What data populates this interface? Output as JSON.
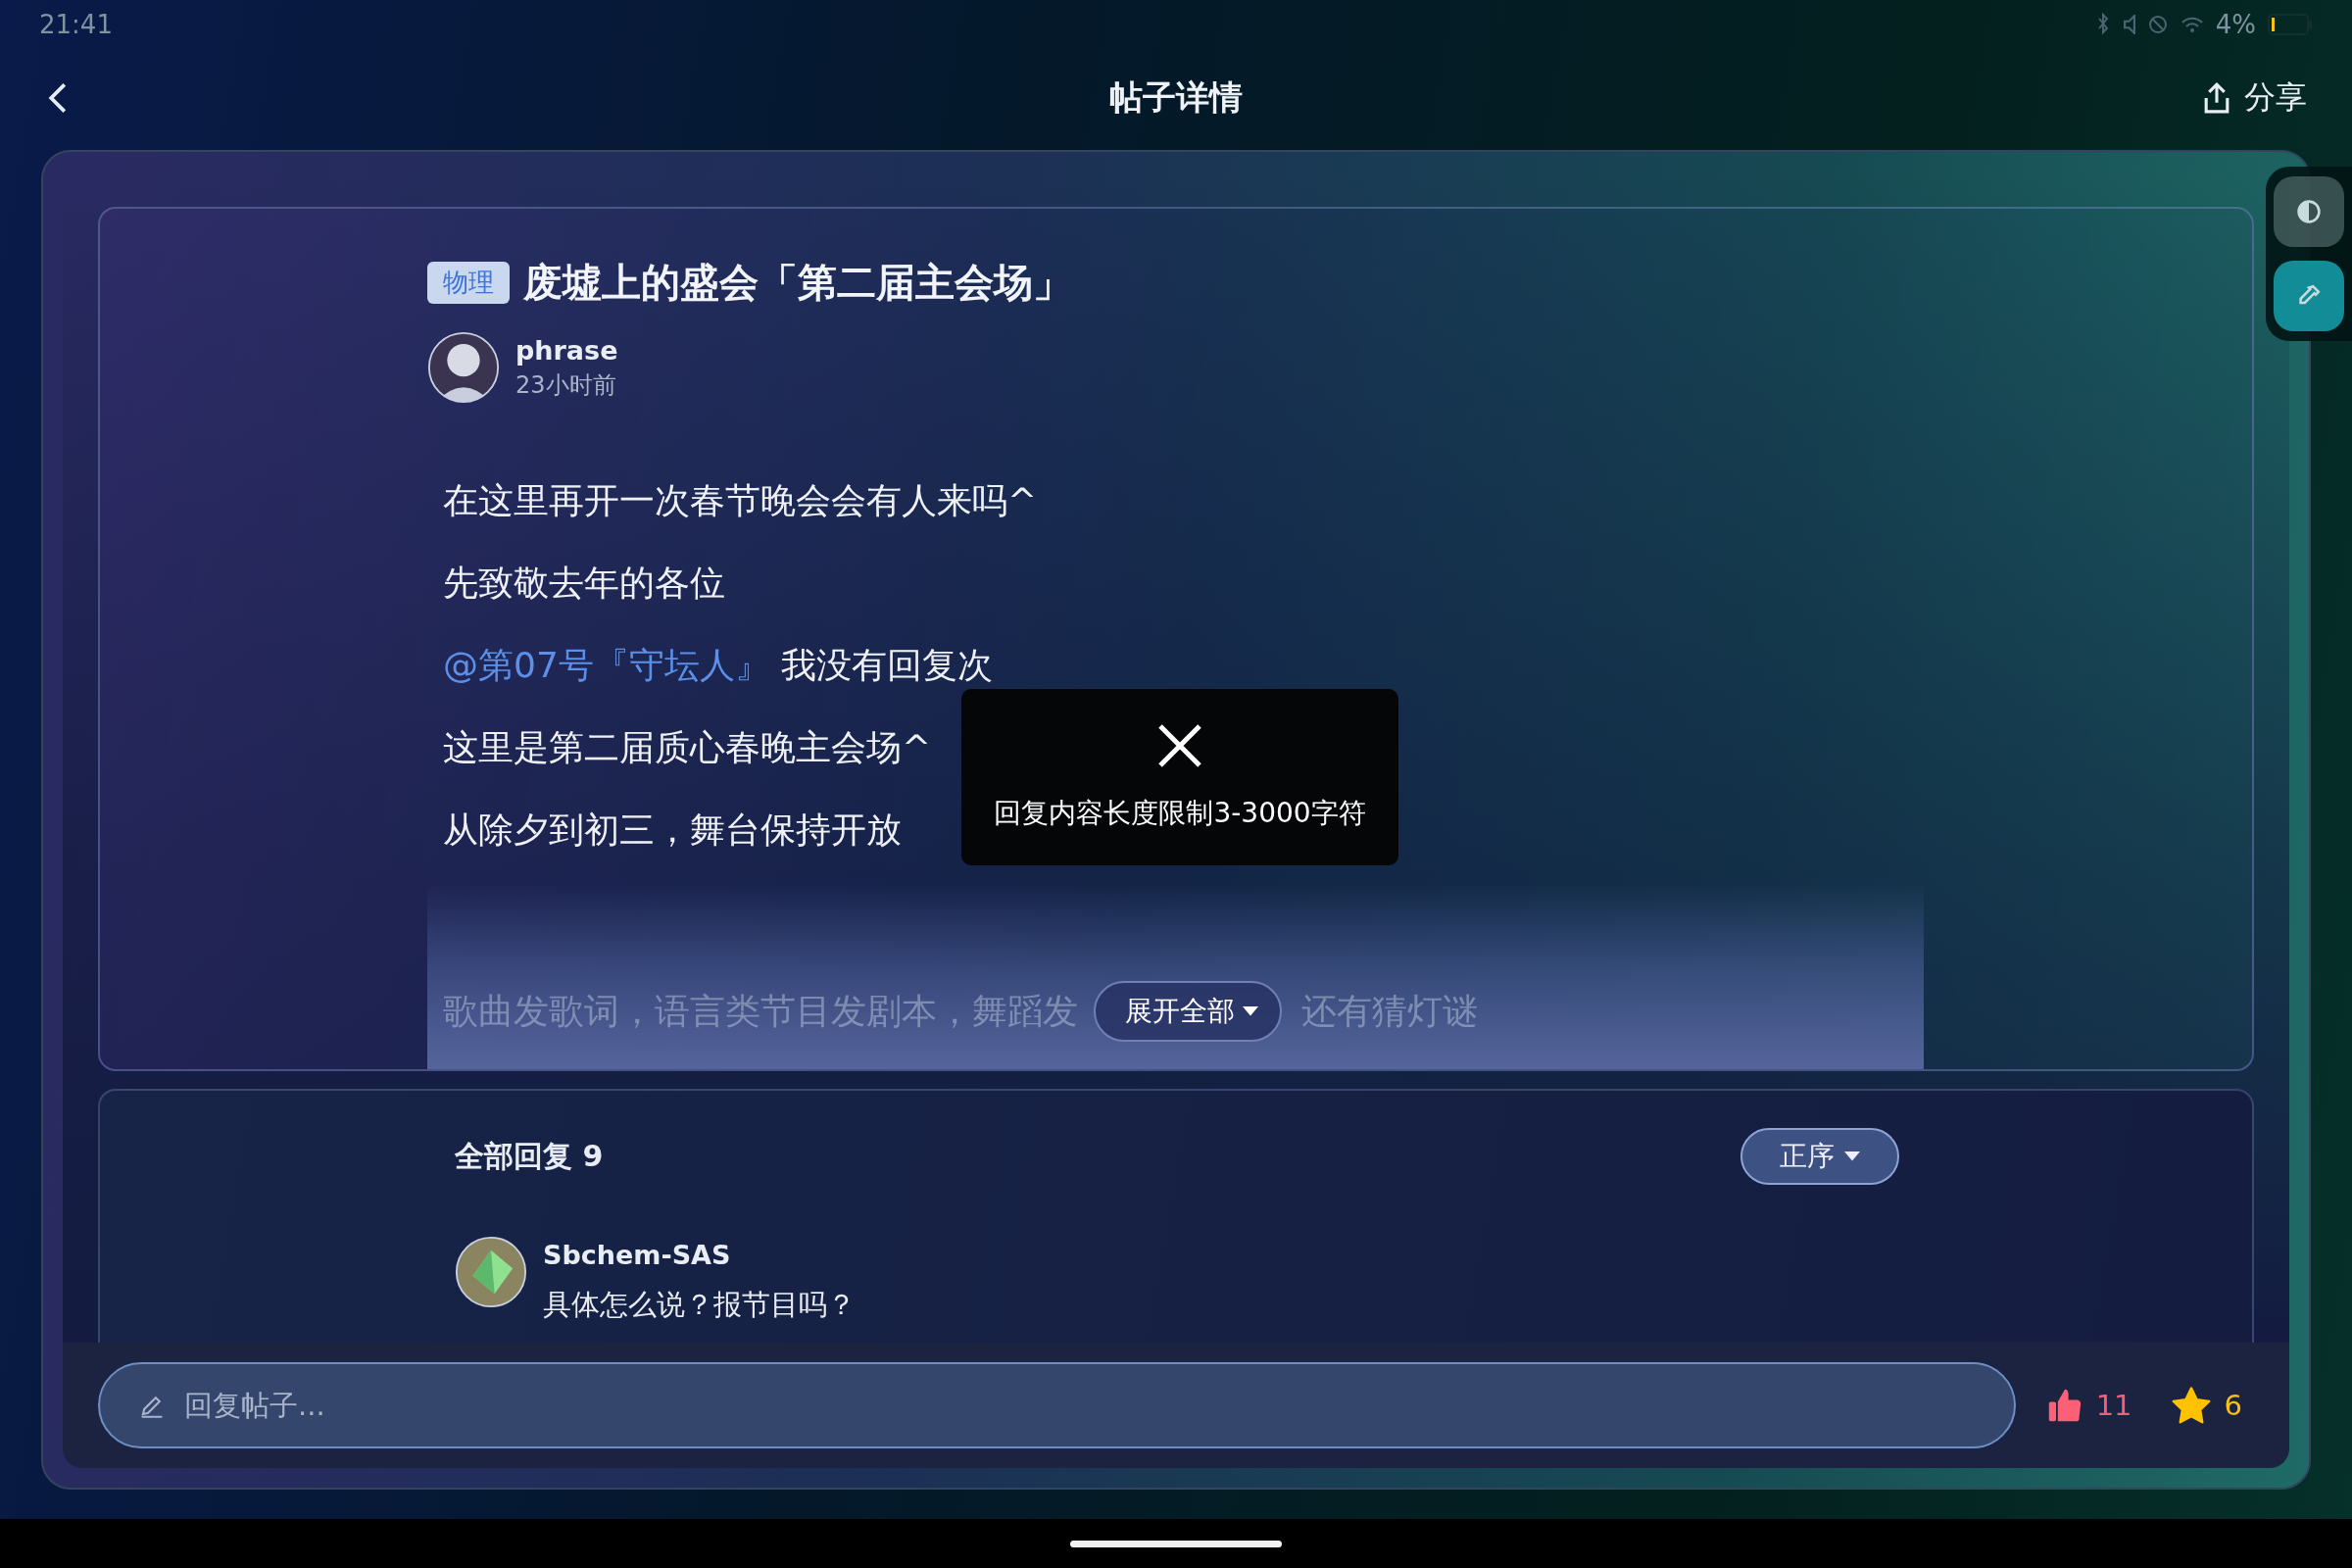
{
  "status_bar": {
    "time": "21:41",
    "battery": "4%"
  },
  "header": {
    "title": "帖子详情",
    "share": "分享"
  },
  "side_tools": [
    {
      "kind": "contrast",
      "selected": false
    },
    {
      "kind": "eyedropper",
      "selected": true
    }
  ],
  "post": {
    "tag": "物理",
    "title": "废墟上的盛会「第二届主会场」",
    "author": {
      "name": "phrase",
      "time": "23小时前"
    },
    "paragraphs": [
      {
        "text": "在这里再开一次春节晚会会有人来吗^"
      },
      {
        "text": "先致敬去年的各位"
      },
      {
        "mention": "@第07号『守坛人』",
        "text": "我没有回复次"
      },
      {
        "text": "这里是第二届质心春晚主会场^"
      },
      {
        "text": "从除夕到初三，舞台保持开放"
      }
    ],
    "faded_line": [
      "歌曲发歌词，语言类节目发剧本，舞蹈发",
      "还有猜灯谜"
    ],
    "expand": "展开全部"
  },
  "toast": {
    "message": "回复内容长度限制3-3000字符"
  },
  "replies": {
    "title": "全部回复 9",
    "sort": "正序",
    "items": [
      {
        "user": "Sbchem-SAS",
        "text": "具体怎么说？报节目吗？"
      }
    ]
  },
  "reply_bar": {
    "placeholder": "回复帖子...",
    "likes": "11",
    "favorites": "6"
  }
}
